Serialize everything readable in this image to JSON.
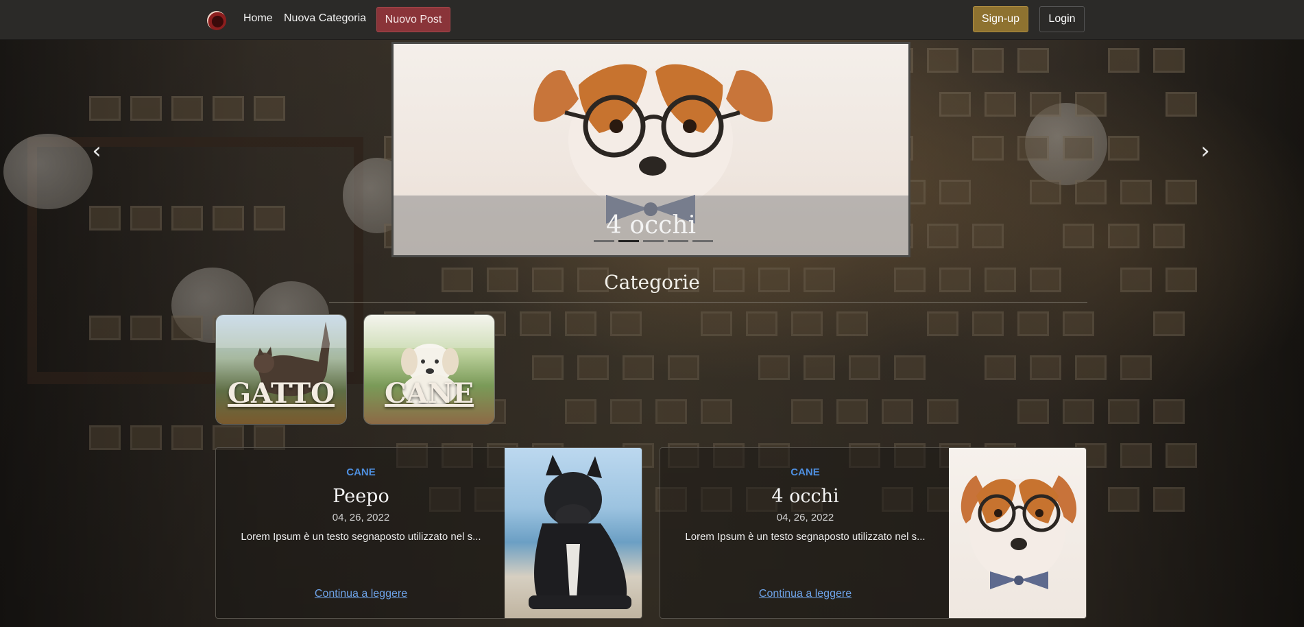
{
  "navbar": {
    "links": [
      "Home",
      "Nuova Categoria"
    ],
    "new_post": "Nuovo Post",
    "signup": "Sign-up",
    "login": "Login"
  },
  "carousel": {
    "caption": "4 occhi",
    "slide_count": 5,
    "active_index": 1
  },
  "categories": {
    "title": "Categorie",
    "items": [
      {
        "label": "GATTO"
      },
      {
        "label": "CANE"
      }
    ]
  },
  "posts": [
    {
      "category": "CANE",
      "title": "Peepo",
      "date": "04, 26, 2022",
      "excerpt": "Lorem Ipsum è un testo segnaposto utilizzato nel s...",
      "link": "Continua a leggere"
    },
    {
      "category": "CANE",
      "title": "4 occhi",
      "date": "04, 26, 2022",
      "excerpt": "Lorem Ipsum è un testo segnaposto utilizzato nel s...",
      "link": "Continua a leggere"
    }
  ],
  "colors": {
    "navbar": "#2b2a28",
    "new_post_button": "#8a3439",
    "signup_button": "#8e7230",
    "category_label": "#4e8fe0",
    "link": "#6ea3e8"
  }
}
